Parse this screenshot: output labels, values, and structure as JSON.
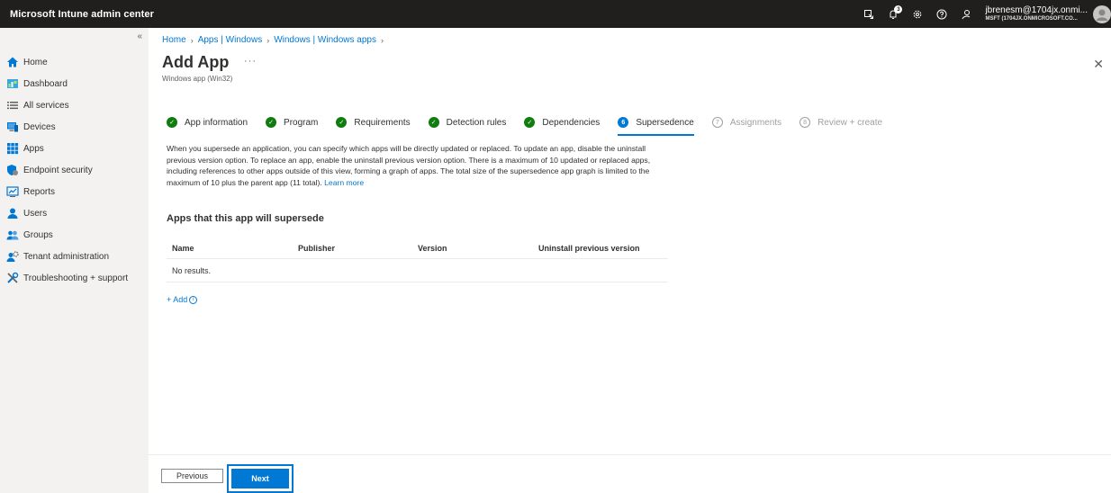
{
  "header": {
    "app_title": "Microsoft Intune admin center",
    "notification_count": "3",
    "user_name": "jbrenesm@1704jx.onmi...",
    "user_org": "MSFT (1704JX.ONMICROSOFT.CO..."
  },
  "sidebar": {
    "collapse_glyph": "«",
    "items": [
      {
        "label": "Home",
        "icon": "home-icon"
      },
      {
        "label": "Dashboard",
        "icon": "dashboard-icon"
      },
      {
        "label": "All services",
        "icon": "list-icon"
      },
      {
        "label": "Devices",
        "icon": "devices-icon"
      },
      {
        "label": "Apps",
        "icon": "apps-icon"
      },
      {
        "label": "Endpoint security",
        "icon": "shield-icon"
      },
      {
        "label": "Reports",
        "icon": "reports-icon"
      },
      {
        "label": "Users",
        "icon": "user-icon"
      },
      {
        "label": "Groups",
        "icon": "groups-icon"
      },
      {
        "label": "Tenant administration",
        "icon": "tenant-icon"
      },
      {
        "label": "Troubleshooting + support",
        "icon": "tools-icon"
      }
    ]
  },
  "breadcrumb": [
    "Home",
    "Apps | Windows",
    "Windows | Windows apps"
  ],
  "page": {
    "title": "Add App",
    "more": "···",
    "subtitle": "Windows app (Win32)",
    "close": "✕"
  },
  "wizard": {
    "steps": [
      {
        "label": "App information",
        "state": "done",
        "num": "✓"
      },
      {
        "label": "Program",
        "state": "done",
        "num": "✓"
      },
      {
        "label": "Requirements",
        "state": "done",
        "num": "✓"
      },
      {
        "label": "Detection rules",
        "state": "done",
        "num": "✓"
      },
      {
        "label": "Dependencies",
        "state": "done",
        "num": "✓"
      },
      {
        "label": "Supersedence",
        "state": "current",
        "num": "6"
      },
      {
        "label": "Assignments",
        "state": "pending",
        "num": "7"
      },
      {
        "label": "Review + create",
        "state": "pending",
        "num": "8"
      }
    ]
  },
  "description": {
    "text": "When you supersede an application, you can specify which apps will be directly updated or replaced. To update an app, disable the uninstall previous version option. To replace an app, enable the uninstall previous version option. There is a maximum of 10 updated or replaced apps, including references to other apps outside of this view, forming a graph of apps. The total size of the supersedence app graph is limited to the maximum of 10 plus the parent app (11 total). ",
    "link": "Learn more"
  },
  "section": {
    "title": "Apps that this app will supersede",
    "columns": [
      "Name",
      "Publisher",
      "Version",
      "Uninstall previous version"
    ],
    "empty": "No results.",
    "add_label": "+ Add",
    "info": "i"
  },
  "footer": {
    "previous": "Previous",
    "next": "Next"
  }
}
